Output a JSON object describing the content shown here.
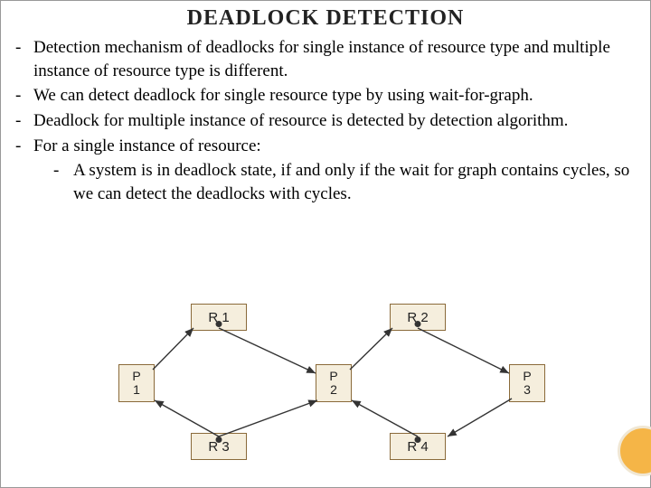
{
  "title": "DEADLOCK DETECTION",
  "bullets": [
    "Detection mechanism of deadlocks for single instance of resource type and multiple instance of resource type is different.",
    "We can detect deadlock for single resource type by using wait-for-graph.",
    "Deadlock for multiple instance of resource is detected by detection algorithm.",
    "For a single instance of resource:"
  ],
  "sub_bullet": "A system is in deadlock state, if and only if the wait for graph contains cycles, so we can detect the deadlocks with cycles.",
  "nodes": {
    "R1": "R 1",
    "R2": "R 2",
    "R3": "R 3",
    "R4": "R 4",
    "P1": "P\n1",
    "P2": "P\n2",
    "P3": "P\n3"
  },
  "chart_data": {
    "type": "diagram",
    "description": "Resource-allocation graph for single-instance resources",
    "resources": [
      "R1",
      "R2",
      "R3",
      "R4"
    ],
    "processes": [
      "P1",
      "P2",
      "P3"
    ],
    "allocation_edges": [
      {
        "from": "R1",
        "to": "P2"
      },
      {
        "from": "R2",
        "to": "P3"
      },
      {
        "from": "R3",
        "to": "P1"
      },
      {
        "from": "R3",
        "to": "P2"
      },
      {
        "from": "R4",
        "to": "P2"
      }
    ],
    "request_edges": [
      {
        "from": "P1",
        "to": "R1"
      },
      {
        "from": "P2",
        "to": "R2"
      },
      {
        "from": "P3",
        "to": "R4"
      }
    ]
  }
}
